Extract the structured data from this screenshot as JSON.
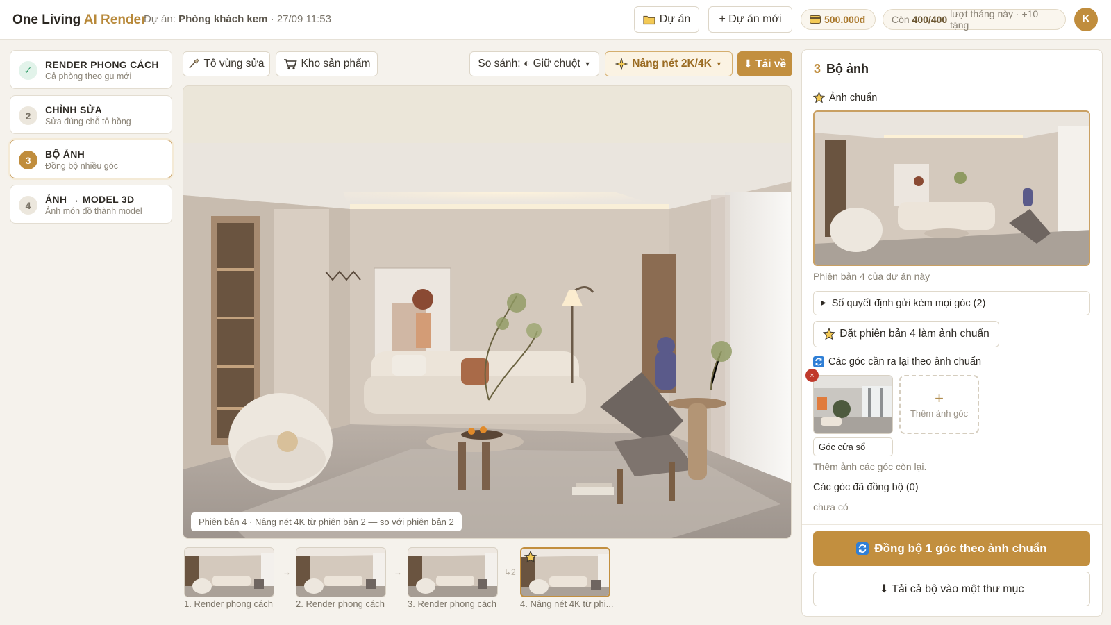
{
  "header": {
    "brand_main": "One Living",
    "brand_ai": "AI Render",
    "project_prefix": "Dự án:",
    "project_name": "Phòng khách kem",
    "project_time": "· 27/09 11:53",
    "projects_button": "Dự án",
    "new_project_button": "+ Dự án mới",
    "credit": "500.000đ",
    "quota_prefix": "Còn",
    "quota_value": "400/400",
    "quota_suffix": "lượt tháng này · +10 tặng",
    "avatar_initial": "K"
  },
  "steps": [
    {
      "badge": "✓",
      "title": "RENDER PHONG CÁCH",
      "subtitle": "Cả phòng theo gu mới"
    },
    {
      "badge": "2",
      "title": "CHỈNH SỬA",
      "subtitle": "Sửa đúng chỗ tô hồng"
    },
    {
      "badge": "3",
      "title": "BỘ ẢNH",
      "subtitle": "Đồng bộ nhiều góc"
    },
    {
      "badge": "4",
      "title": "ẢNH → MODEL 3D",
      "subtitle": "Ảnh món đồ thành model"
    }
  ],
  "toolbar": {
    "paint_label": "Tô vùng sửa",
    "products_label": "Kho sản phẩm",
    "compare_label": "So sánh: ◐ Giữ chuột",
    "upscale_label": "Nâng nét 2K/4K",
    "download_label": "⬇ Tải về"
  },
  "canvas": {
    "caption": "Phiên bản 4 · Nâng nét 4K từ phiên bản 2 — so với phiên bản 2"
  },
  "versions": [
    {
      "label": "1. Render phong cách"
    },
    {
      "label": "2. Render phong cách"
    },
    {
      "label": "3. Render phong cách"
    },
    {
      "label": "4. Nâng nét 4K từ phi..."
    }
  ],
  "version_arrows": [
    "→",
    "→",
    "↳2"
  ],
  "panel": {
    "number": "3",
    "title": "Bộ ảnh",
    "reference_label": "Ảnh chuẩn",
    "reference_caption": "Phiên bản 4 của dự án này",
    "accordion_label": "Số quyết định gửi kèm mọi góc (2)",
    "set_reference_button": "Đặt phiên bản 4 làm ảnh chuẩn",
    "angles_heading": "Các góc cần ra lại theo ảnh chuẩn",
    "remove_icon": "×",
    "angle_name": "Góc cửa sổ",
    "add_angle_label": "Thêm ảnh góc",
    "add_more_hint": "Thêm ảnh các góc còn lại.",
    "synced_heading": "Các góc đã đồng bộ (0)",
    "synced_empty": "chưa có",
    "sync_button": "Đồng bộ 1 góc theo ảnh chuẩn",
    "download_all_button": "⬇ Tải cả bộ vào một thư mục"
  },
  "colors": {
    "accent": "#c28f3f",
    "brand_ai": "#b8893a",
    "success": "#2e9b67",
    "danger": "#c0392b"
  },
  "icons": [
    "folder-icon",
    "credit-card-icon",
    "brush-icon",
    "cart-icon",
    "sparkle-icon",
    "star-icon",
    "sync-icon",
    "download-icon",
    "plus-icon"
  ]
}
